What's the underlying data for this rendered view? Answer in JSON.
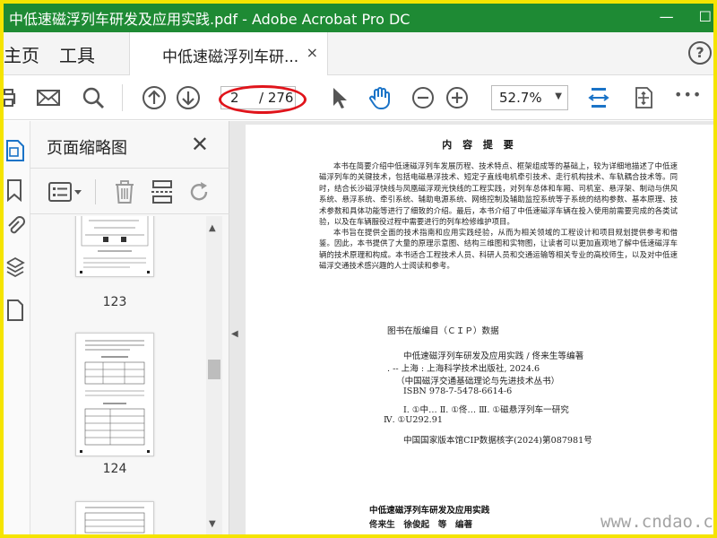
{
  "window": {
    "title": "中低速磁浮列车研发及应用实践.pdf - Adobe Acrobat Pro DC",
    "controls": [
      "—",
      "☐"
    ]
  },
  "nav": {
    "home_label": "主页",
    "tools_label": "工具",
    "doc_tab_label": "中低速磁浮列车研...",
    "close_tab": "×",
    "help": "?"
  },
  "toolbar": {
    "current_page": "2",
    "total_pages": "/ 276",
    "zoom": "52.7%",
    "more": "•••"
  },
  "panel": {
    "title": "页面缩略图",
    "close": "✕",
    "thumbnails": [
      {
        "label": "123"
      },
      {
        "label": "124"
      }
    ]
  },
  "document": {
    "heading": "内 容 提 要",
    "para1": "本书在简要介绍中低速磁浮列车发展历程、技术特点、框架组成等的基础上，较为详细地描述了中低速磁浮列车的关键技术，包括电磁悬浮技术、短定子直线电机牵引技术、走行机构技术、车轨耦合技术等。同时，结合长沙磁浮快线与凤凰磁浮观光快线的工程实践，对列车总体和车厢、司机室、悬浮架、制动与供风系统、悬浮系统、牵引系统、辅助电源系统、网络控制及辅助监控系统等子系统的结构参数、基本原理、技术参数和具体功能等进行了细致的介绍。最后，本书介绍了中低速磁浮车辆在投入使用前需要完成的各类试验，以及在车辆服役过程中需要进行的列车检修维护项目。",
    "para2": "本书旨在提供全面的技术指南和应用实践经验，从而为相关领域的工程设计和项目规划提供参考和借鉴。因此，本书提供了大量的原理示意图、结构三维图和实物图，让读者可以更加直观地了解中低速磁浮车辆的技术原理和构成。本书适合工程技术人员、科研人员和交通运输等相关专业的高校师生，以及对中低速磁浮交通技术感兴趣的人士阅读和参考。",
    "cip_title": "图书在版编目（ＣＩＰ）数据",
    "cip_lines": [
      "中低速磁浮列车研发及应用实践 / 佟来生等编著",
      ". -- 上海 : 上海科学技术出版社, 2024.6",
      "（中国磁浮交通基础理论与先进技术丛书）",
      "ISBN 978-7-5478-6614-6"
    ],
    "cip_class1": "Ⅰ. ①中…  Ⅱ. ①佟…  Ⅲ. ①磁悬浮列车一研究",
    "cip_class2": "Ⅳ. ①U292.91",
    "cip_record": "中国国家版本馆CIP数据核字(2024)第087981号",
    "book_title": "中低速磁浮列车研发及应用实践",
    "authors": "佟来生　徐俊起　等　编著",
    "site_watermark": "www.cndao.com"
  },
  "colors": {
    "title_bar": "#1e8a34",
    "accent_blue": "#1a73c7",
    "annotation_red": "#e0141b",
    "frame_yellow": "#f5e400"
  }
}
